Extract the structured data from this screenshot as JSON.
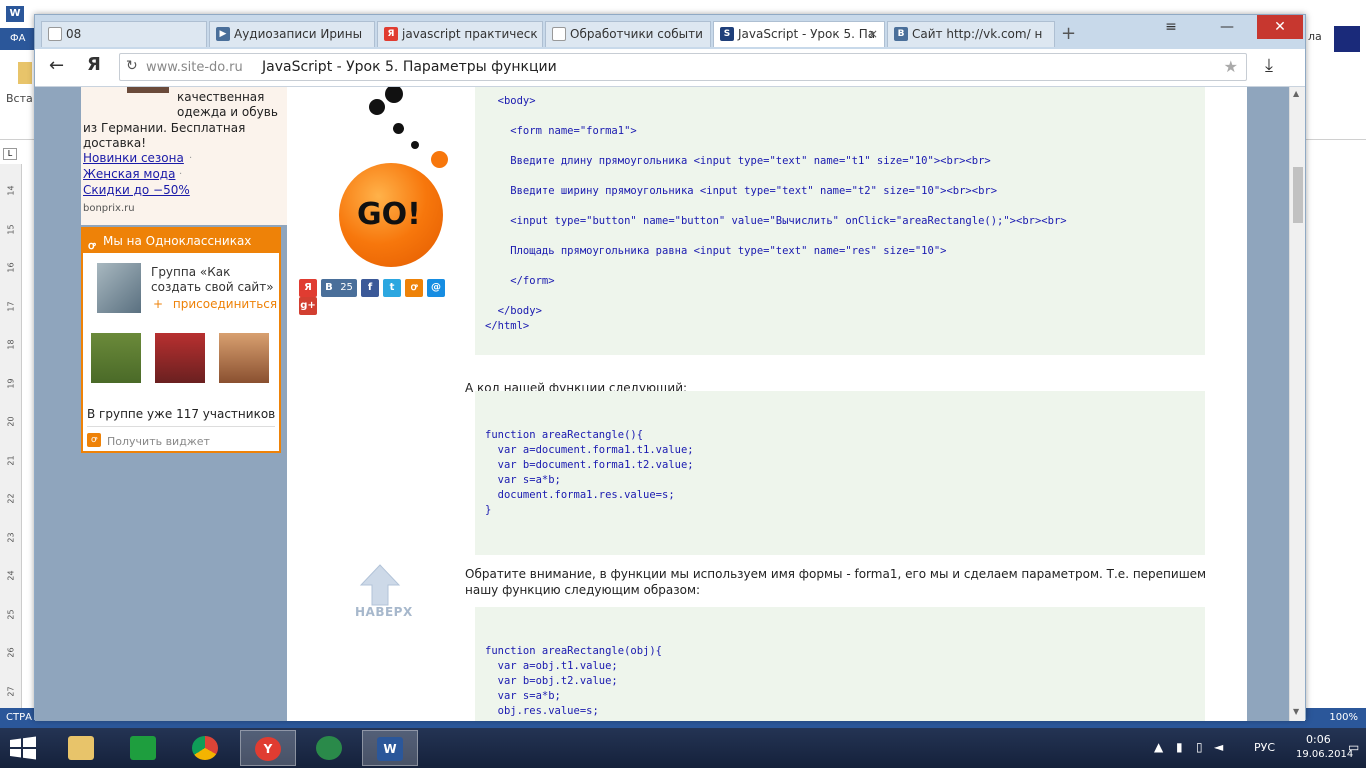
{
  "word": {
    "ribbon_tab": "ФА",
    "paste_label": "Вста",
    "ruler_numbers": [
      "14",
      "15",
      "16",
      "17",
      "18",
      "19",
      "20",
      "21",
      "22",
      "23",
      "24",
      "25",
      "26",
      "27"
    ],
    "status_left": "СТРА",
    "zoom": "100%",
    "right_text": "ла"
  },
  "browser": {
    "tabs": [
      {
        "label": "08",
        "icon_color": "#ffffff",
        "icon": "doc-icon"
      },
      {
        "label": "Аудиозаписи Ирины",
        "icon_color": "#4a6f9a",
        "icon": "play-icon"
      },
      {
        "label": "javascript практическ",
        "icon_color": "#e03c31",
        "icon": "yandex-icon"
      },
      {
        "label": "Обработчики событи",
        "icon_color": "#ffffff",
        "icon": "doc-icon"
      },
      {
        "label": "JavaScript - Урок 5. Па",
        "icon_color": "#1f3f7a",
        "icon": "site-icon"
      },
      {
        "label": "Сайт http://vk.com/ н",
        "icon_color": "#4a6f9a",
        "icon": "vk-icon"
      }
    ],
    "url_domain": "www.site-do.ru",
    "page_title": "JavaScript - Урок 5. Параметры функции"
  },
  "ad": {
    "text1": "качественная одежда и обувь",
    "text2": "из Германии. Бесплатная доставка!",
    "links": [
      "Новинки сезона",
      "Женская мода",
      "Скидки до −50%"
    ],
    "domain": "bonprix.ru"
  },
  "ok_widget": {
    "title": "Мы на Одноклассниках",
    "group_name": "Группа «Как создать свой сайт»",
    "join": "присоединиться",
    "count": "В группе уже 117 участников",
    "get_widget": "Получить виджет"
  },
  "logo": {
    "text": "GO!"
  },
  "social": {
    "vk_count": "25"
  },
  "up": {
    "label": "НАВЕРХ"
  },
  "content": {
    "code1": [
      "  <body>",
      "",
      "    <form name=\"forma1\">",
      "",
      "    Введите длину прямоугольника <input type=\"text\" name=\"t1\" size=\"10\"><br><br>",
      "",
      "    Введите ширину прямоугольника <input type=\"text\" name=\"t2\" size=\"10\"><br><br>",
      "",
      "    <input type=\"button\" name=\"button\" value=\"Вычислить\" onClick=\"areaRectangle();\"><br><br>",
      "",
      "    Площадь прямоугольника равна <input type=\"text\" name=\"res\" size=\"10\">",
      "",
      "    </form>",
      "",
      "  </body>",
      "</html>"
    ],
    "para1": "А код нашей функции следующий:",
    "code2": [
      "function areaRectangle(){",
      "  var a=document.forma1.t1.value;",
      "  var b=document.forma1.t2.value;",
      "  var s=a*b;",
      "  document.forma1.res.value=s;",
      "}"
    ],
    "para2": "Обратите внимание, в функции мы используем имя формы - forma1, его мы и сделаем параметром. Т.е. перепишем нашу функцию следующим образом:",
    "code3": [
      "function areaRectangle(obj){",
      "  var a=obj.t1.value;",
      "  var b=obj.t2.value;",
      "  var s=a*b;",
      "  obj.res.value=s;"
    ]
  },
  "tray": {
    "lang": "РУС",
    "time": "0:06",
    "date": "19.06.2014"
  }
}
